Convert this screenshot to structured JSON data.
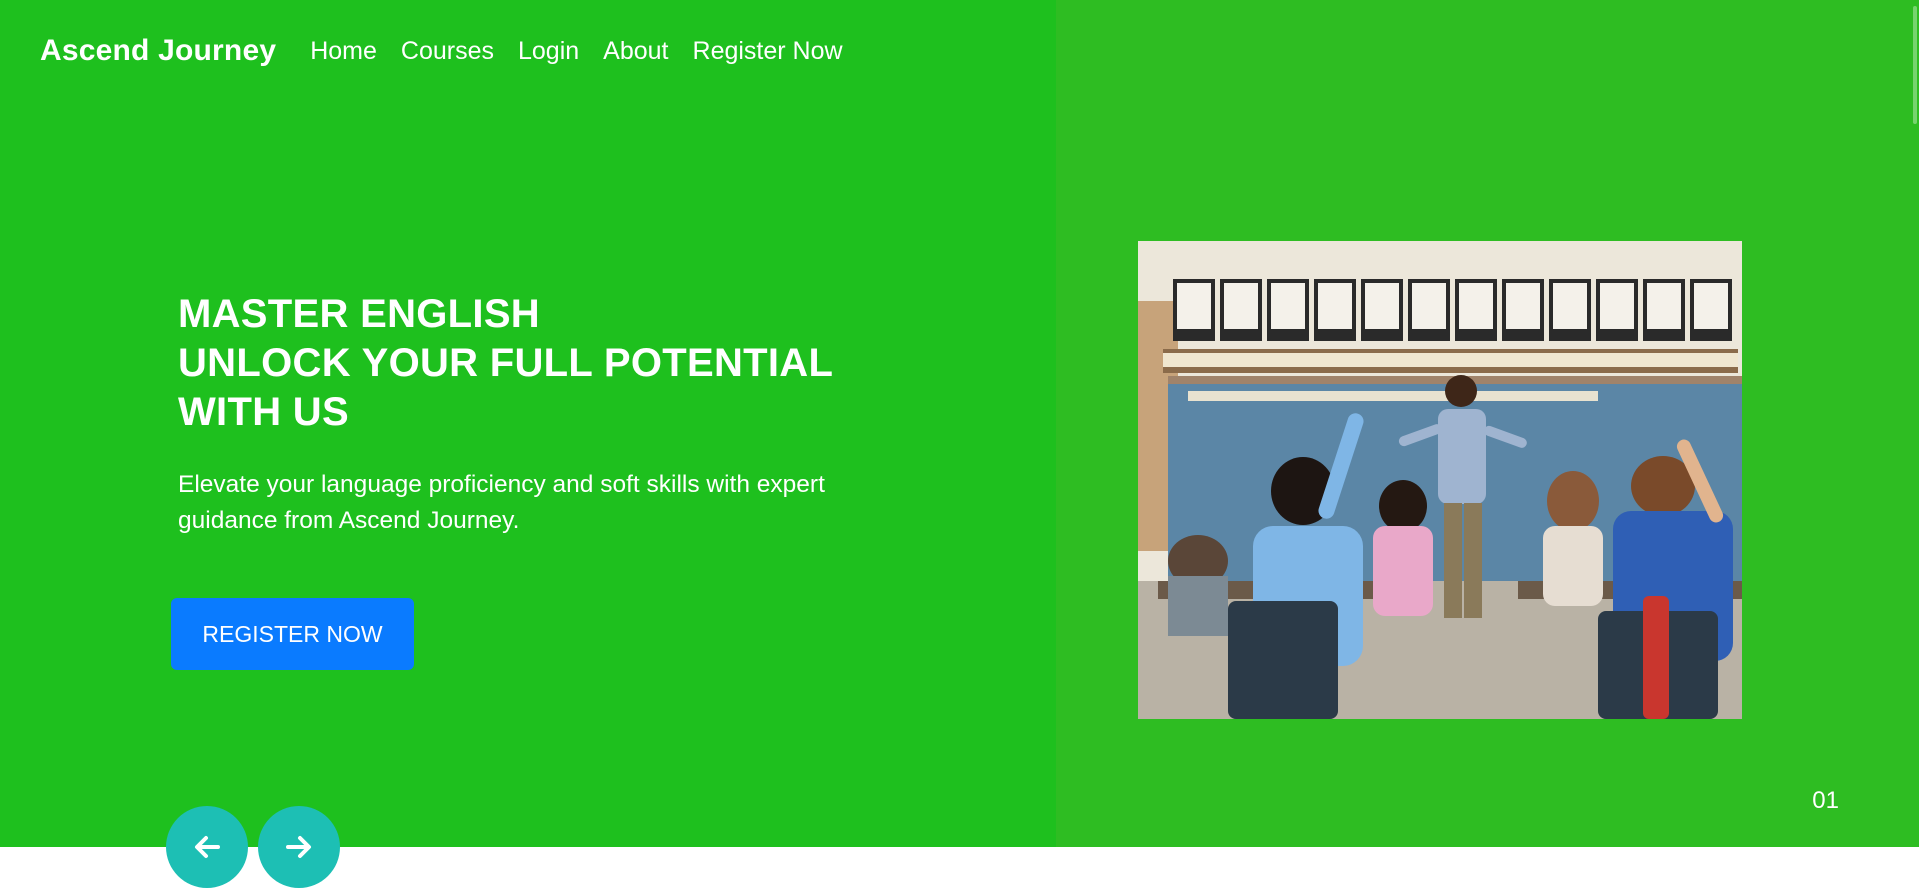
{
  "nav": {
    "brand": "Ascend Journey",
    "links": [
      "Home",
      "Courses",
      "Login",
      "About",
      "Register Now"
    ]
  },
  "hero": {
    "headline_lines": [
      "MASTER ENGLISH",
      "UNLOCK YOUR FULL POTENTIAL",
      "WITH US"
    ],
    "subtext_lines": [
      "Elevate your language proficiency and soft skills with expert",
      "guidance from Ascend Journey."
    ],
    "cta_label": "REGISTER NOW"
  },
  "carousel": {
    "slide_number": "01",
    "prev_icon": "arrow-left-icon",
    "next_icon": "arrow-right-icon"
  },
  "colors": {
    "hero_left_bg": "#1ec01e",
    "hero_right_bg": "#2ebd22",
    "cta_bg": "#0a7bff",
    "arrow_bg": "#1dbfb4"
  }
}
